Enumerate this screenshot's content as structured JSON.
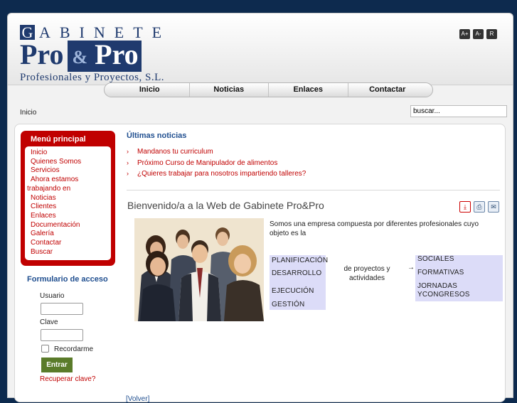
{
  "logo": {
    "line1_first": "G",
    "line1_rest": "ABINETE",
    "line2_a": "Pro",
    "line2_amp": "&",
    "line2_b": "Pro",
    "line3": "Profesionales y Proyectos, S.L."
  },
  "font_controls": [
    "A+",
    "A-",
    "R"
  ],
  "nav": [
    "Inicio",
    "Noticias",
    "Enlaces",
    "Contactar"
  ],
  "breadcrumb": "Inicio",
  "search": {
    "value": "buscar..."
  },
  "menu": {
    "title": "Menú principal",
    "items": [
      "Inicio",
      "Quienes Somos",
      "Servicios",
      "Ahora estamos",
      "trabajando en",
      "Noticias",
      "Clientes",
      "Enlaces",
      "Documentación",
      "Galería",
      "Contactar",
      "Buscar"
    ]
  },
  "login": {
    "title": "Formulario de acceso",
    "user_label": "Usuario",
    "pass_label": "Clave",
    "remember_label": "Recordarme",
    "submit": "Entrar",
    "forgot": "Recuperar clave?"
  },
  "news": {
    "title": "Últimas noticias",
    "items": [
      "Mandanos tu curriculum",
      "Próximo Curso de Manipulador de alimentos",
      "¿Quieres trabajar para nosotros impartiendo talleres?"
    ]
  },
  "article": {
    "title": "Bienvenido/a a la Web de Gabinete Pro&Pro",
    "intro": "Somos una empresa compuesta por diferentes profesionales cuyo objeto es la",
    "left_items": [
      "PLANIFICACIÓN",
      "DESARROLLO",
      "EJECUCIÓN",
      "GESTIÓN"
    ],
    "middle": "de proyectos y actividades",
    "arrow": "→",
    "right_items": [
      "SOCIALES",
      "FORMATIVAS",
      "JORNADAS",
      "YCONGRESOS"
    ]
  },
  "back_link": "[Volver]",
  "colors": {
    "background": "#0d2a4e",
    "brand_blue": "#1f3a6e",
    "menu_red": "#c00000",
    "button_green": "#5a7b2a"
  }
}
